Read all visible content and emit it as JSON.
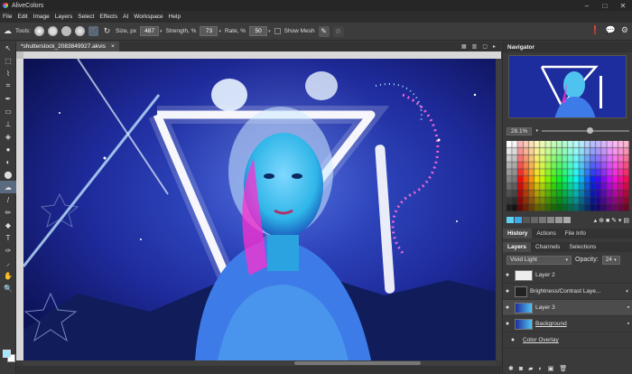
{
  "app": {
    "title": "AliveColors"
  },
  "menu": [
    "File",
    "Edit",
    "Image",
    "Layers",
    "Select",
    "Effects",
    "AI",
    "Workspace",
    "Help"
  ],
  "options": {
    "tools_label": "Tools:",
    "size_label": "Size, px",
    "size_value": "487",
    "strength_label": "Strength, %",
    "strength_value": "73",
    "rate_label": "Rate, %",
    "rate_value": "50",
    "show_mesh_label": "Show Mesh"
  },
  "document": {
    "tab_title": "*shutterstock_2083849927.akvis",
    "close": "×"
  },
  "navigator": {
    "title": "Navigator",
    "zoom": "28.1%"
  },
  "colors": {
    "foreground": "#9fe8ff",
    "background": "#ffffff"
  },
  "history_tabs": [
    "History",
    "Actions",
    "File Info"
  ],
  "layers_tabs": [
    "Layers",
    "Channels",
    "Selections"
  ],
  "blend": {
    "mode": "Vivid Light",
    "opacity_label": "Opacity:",
    "opacity_value": "24"
  },
  "layers": [
    {
      "name": "Layer 2"
    },
    {
      "name": "Brightness/Contrast Laye..."
    },
    {
      "name": "Layer 3"
    },
    {
      "name": "Background"
    },
    {
      "name": "Color Overlay"
    }
  ]
}
